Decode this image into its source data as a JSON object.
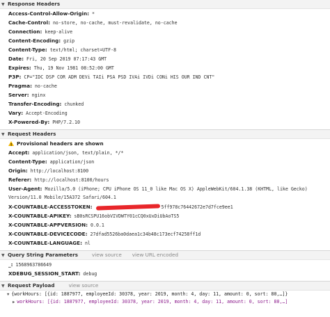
{
  "response_headers": {
    "title": "Response Headers",
    "items": [
      {
        "key": "Access-Control-Allow-Origin:",
        "value": "*"
      },
      {
        "key": "Cache-Control:",
        "value": "no-store, no-cache, must-revalidate, no-cache"
      },
      {
        "key": "Connection:",
        "value": "keep-alive"
      },
      {
        "key": "Content-Encoding:",
        "value": "gzip"
      },
      {
        "key": "Content-Type:",
        "value": "text/html; charset=UTF-8"
      },
      {
        "key": "Date:",
        "value": "Fri, 20 Sep 2019 07:17:43 GMT"
      },
      {
        "key": "Expires:",
        "value": "Thu, 19 Nov 1981 08:52:00 GMT"
      },
      {
        "key": "P3P:",
        "value": "CP=\"IDC DSP COR ADM DEVi TAIi PSA PSD IVAi IVDi CONi HIS OUR IND CNT\""
      },
      {
        "key": "Pragma:",
        "value": "no-cache"
      },
      {
        "key": "Server:",
        "value": "nginx"
      },
      {
        "key": "Transfer-Encoding:",
        "value": "chunked"
      },
      {
        "key": "Vary:",
        "value": "Accept-Encoding"
      },
      {
        "key": "X-Powered-By:",
        "value": "PHP/7.2.10"
      }
    ]
  },
  "request_headers": {
    "title": "Request Headers",
    "warning": "Provisional headers are shown",
    "items": [
      {
        "key": "Accept:",
        "value": "application/json, text/plain, */*"
      },
      {
        "key": "Content-Type:",
        "value": "application/json"
      },
      {
        "key": "Origin:",
        "value": "http://localhost:8100"
      },
      {
        "key": "Referer:",
        "value": "http://localhost:8100/hours"
      },
      {
        "key": "User-Agent:",
        "value": "Mozilla/5.0 (iPhone; CPU iPhone OS 11_0 like Mac OS X) AppleWebKit/604.1.38 (KHTML, like Gecko) Version/11.0 Mobile/15A372 Safari/604.1"
      },
      {
        "key": "X-COUNTABLE-ACCESSTOKEN:",
        "value": "5ff978c76442672e7d7fce9ee1"
      },
      {
        "key": "X-COUNTABLE-APIKEY:",
        "value": "sB0sRCSPU16obVIVDWTY01cCQ0xUxDiUbAoTS5"
      },
      {
        "key": "X-COUNTABLE-APPVERSION:",
        "value": "0.0.1"
      },
      {
        "key": "X-COUNTABLE-DEVICECODE:",
        "value": "27dfad5526ba0daea1c34b48c173ecf74258ff1d"
      },
      {
        "key": "X-COUNTABLE-LANGUAGE:",
        "value": "nl"
      }
    ]
  },
  "query_string": {
    "title": "Query String Parameters",
    "view_source": "view source",
    "view_url_encoded": "view URL encoded",
    "items": [
      {
        "key": "_:",
        "value": "1568963786649"
      },
      {
        "key": "XDEBUG_SESSION_START:",
        "value": "debug"
      }
    ]
  },
  "request_payload": {
    "title": "Request Payload",
    "view_source": "view source",
    "line1": "{workHours: [{id: 1887977, employeeId: 30378, year: 2019, month: 4, day: 11, amount: 0, sort: 80,…]}",
    "line2": "workHours: [{id: 1887977, employeeId: 30378, year: 2019, month: 4, day: 11, amount: 0, sort: 80,…]"
  }
}
